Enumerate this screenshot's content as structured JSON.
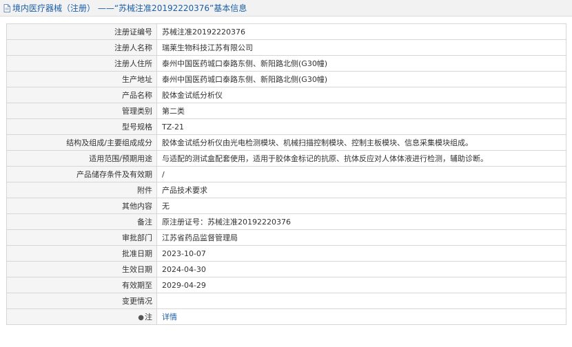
{
  "header": {
    "breadcrumb_section": "境内医疗器械（注册）",
    "separator": "——",
    "record_title": "“苏械注准20192220376”基本信息"
  },
  "rows": [
    {
      "label": "注册证编号",
      "value": "苏械注准20192220376"
    },
    {
      "label": "注册人名称",
      "value": "瑞莱生物科技江苏有限公司"
    },
    {
      "label": "注册人住所",
      "value": "泰州中国医药城口泰路东侧、新阳路北侧(G30幢)"
    },
    {
      "label": "生产地址",
      "value": "泰州中国医药城口泰路东侧、新阳路北侧(G30幢)"
    },
    {
      "label": "产品名称",
      "value": "胶体金试纸分析仪"
    },
    {
      "label": "管理类别",
      "value": "第二类"
    },
    {
      "label": "型号规格",
      "value": "TZ-21"
    },
    {
      "label": "结构及组成/主要组成成分",
      "value": "胶体金试纸分析仪由光电检测模块、机械扫描控制模块、控制主板模块、信息采集模块组成。"
    },
    {
      "label": "适用范围/预期用途",
      "value": "与适配的测试盒配套使用，适用于胶体金标记的抗原、抗体反应对人体体液进行检测，辅助诊断。"
    },
    {
      "label": "产品储存条件及有效期",
      "value": "/"
    },
    {
      "label": "附件",
      "value": "产品技术要求"
    },
    {
      "label": "其他内容",
      "value": "无"
    },
    {
      "label": "备注",
      "value": "原注册证号：苏械注准20192220376"
    },
    {
      "label": "审批部门",
      "value": "江苏省药品监督管理局"
    },
    {
      "label": "批准日期",
      "value": "2023-10-07"
    },
    {
      "label": "生效日期",
      "value": "2024-04-30"
    },
    {
      "label": "有效期至",
      "value": "2029-04-29"
    },
    {
      "label": "变更情况",
      "value": ""
    }
  ],
  "note_row": {
    "label": "注",
    "icon": "pin-icon",
    "link": "详情"
  },
  "colors": {
    "link": "#1a5fa8",
    "label_bg": "#f5f5f5",
    "border": "#d6d6d6",
    "header_bg": "#f2f2f2"
  }
}
